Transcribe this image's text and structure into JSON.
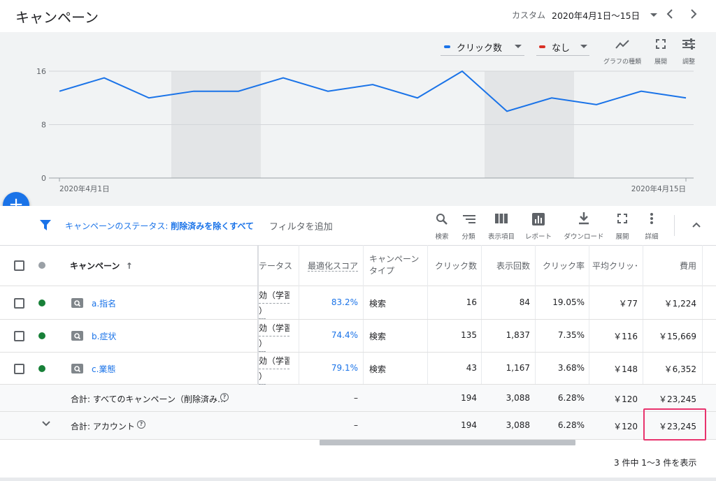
{
  "header": {
    "title": "キャンペーン",
    "date_range_label": "カスタム",
    "date_range_value": "2020年4月1日〜15日"
  },
  "chart_controls": {
    "metric1": "クリック数",
    "metric1_color": "#1a73e8",
    "metric2": "なし",
    "metric2_color": "#d93025",
    "chart_type_label": "グラフの種類",
    "expand_label": "展開",
    "adjust_label": "調整"
  },
  "chart_data": {
    "type": "line",
    "x": [
      "2020-04-01",
      "2020-04-02",
      "2020-04-03",
      "2020-04-04",
      "2020-04-05",
      "2020-04-06",
      "2020-04-07",
      "2020-04-08",
      "2020-04-09",
      "2020-04-10",
      "2020-04-11",
      "2020-04-12",
      "2020-04-13",
      "2020-04-14",
      "2020-04-15"
    ],
    "series": [
      {
        "name": "クリック数",
        "values": [
          13,
          15,
          12,
          13,
          13,
          15,
          13,
          14,
          12,
          16,
          10,
          12,
          11,
          13,
          12
        ]
      }
    ],
    "ylim": [
      0,
      16
    ],
    "yticks": [
      "0",
      "8",
      "16"
    ],
    "x_start_label": "2020年4月1日",
    "x_end_label": "2020年4月15日",
    "weekend_ranges": [
      [
        "2020-04-04",
        "2020-04-05"
      ],
      [
        "2020-04-11",
        "2020-04-12"
      ]
    ],
    "grid": true
  },
  "filter": {
    "status_label": "キャンペーンのステータス:",
    "status_value": "削除済みを除くすべて",
    "add_filter": "フィルタを追加"
  },
  "toolbar": {
    "search": "検索",
    "segment": "分類",
    "columns": "表示項目",
    "report": "レポート",
    "download": "ダウンロード",
    "expand": "展開",
    "details": "詳細"
  },
  "table": {
    "headers": {
      "campaign": "キャンペーン",
      "status": "テータス",
      "opt_score": "最適化スコア",
      "campaign_type": "キャンペーンタイプ",
      "clicks": "クリック数",
      "impressions": "表示回数",
      "ctr": "クリック率",
      "avg_cpc": "平均クリッ･",
      "cost": "費用"
    },
    "rows": [
      {
        "name": "a.指名",
        "status_line1": "効（学習",
        "status_line2": "）",
        "opt_score": "83.2%",
        "type": "検索",
        "clicks": "16",
        "impressions": "84",
        "ctr": "19.05%",
        "avg_cpc": "￥77",
        "cost": "￥1,224"
      },
      {
        "name": "b.症状",
        "status_line1": "効（学習",
        "status_line2": "）",
        "opt_score": "74.4%",
        "type": "検索",
        "clicks": "135",
        "impressions": "1,837",
        "ctr": "7.35%",
        "avg_cpc": "￥116",
        "cost": "￥15,669"
      },
      {
        "name": "c.業態",
        "status_line1": "効（学習",
        "status_line2": "）",
        "opt_score": "79.1%",
        "type": "検索",
        "clicks": "43",
        "impressions": "1,167",
        "ctr": "3.68%",
        "avg_cpc": "￥148",
        "cost": "￥6,352"
      }
    ],
    "total_all": {
      "label": "合計: すべてのキャンペーン（削除済み…",
      "opt_score": "–",
      "clicks": "194",
      "impressions": "3,088",
      "ctr": "6.28%",
      "avg_cpc": "￥120",
      "cost": "￥23,245"
    },
    "total_account": {
      "label": "合計: アカウント",
      "opt_score": "–",
      "clicks": "194",
      "impressions": "3,088",
      "ctr": "6.28%",
      "avg_cpc": "￥120",
      "cost": "￥23,245"
    }
  },
  "pagination": {
    "text": "3 件中 1〜3 件を表示"
  },
  "highlight_color": "#e8336d"
}
